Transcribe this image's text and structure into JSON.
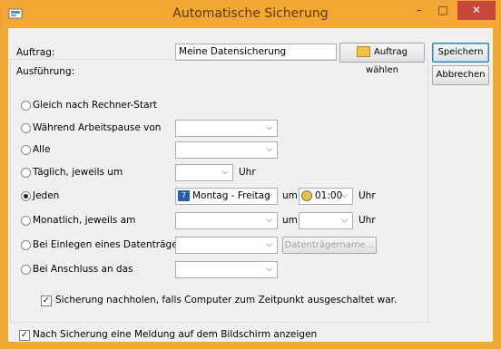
{
  "window": {
    "title": "Automatische Sicherung",
    "close_glyph": "✕",
    "min_glyph": "–",
    "max_glyph": "□"
  },
  "auftrag": {
    "label": "Auftrag:",
    "value": "Meine Datensicherung",
    "choose_button": "Auftrag wählen"
  },
  "buttons": {
    "save": "Speichern",
    "cancel": "Abbrechen"
  },
  "ausfuehrung": {
    "label": "Ausführung:",
    "options": [
      {
        "label": "Gleich nach Rechner-Start"
      },
      {
        "label": "Während Arbeitspause von"
      },
      {
        "label": "Alle"
      },
      {
        "label": "Täglich, jeweils um",
        "suffix": "Uhr"
      },
      {
        "label": "Jeden",
        "day_value": "Montag - Freitag",
        "um": "um",
        "time_value": "01:00",
        "suffix": "Uhr"
      },
      {
        "label": "Monatlich, jeweils am",
        "um": "um",
        "suffix": "Uhr"
      },
      {
        "label": "Bei Einlegen eines Datenträgers in",
        "media_button": "Datenträgername..."
      },
      {
        "label": "Bei Anschluss an das"
      }
    ],
    "catch_up": "Sicherung nachholen, falls Computer zum Zeitpunkt ausgeschaltet war."
  },
  "notify": "Nach Sicherung eine Meldung auf dem Bildschirm anzeigen",
  "icons": {
    "app": "app-icon",
    "folder": "folder-icon",
    "calendar": "calendar-icon",
    "clock": "clock-icon",
    "dropdown": "chevron-down-icon",
    "check": "✓"
  }
}
